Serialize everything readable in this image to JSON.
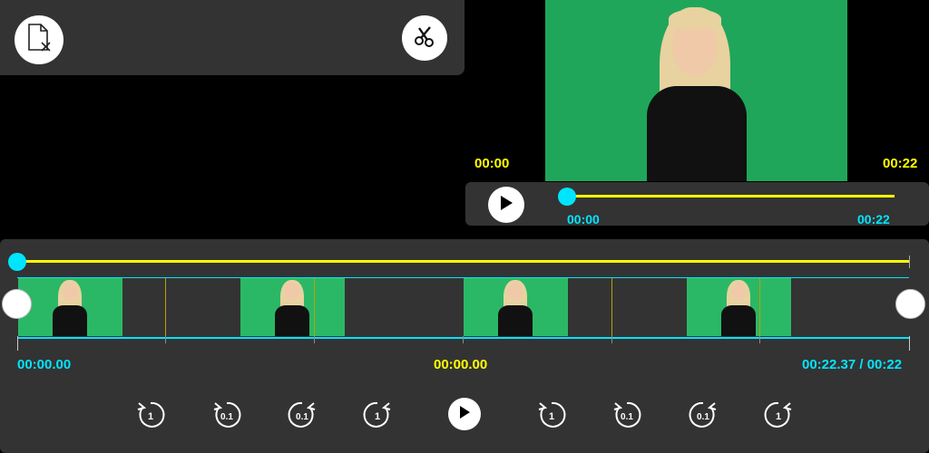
{
  "toolbar": {
    "left_icon": "file-remove-icon",
    "right_icon": "scissors-icon"
  },
  "player": {
    "time_start_label": "00:00",
    "time_end_label": "00:22",
    "current_time": "00:00",
    "duration": "00:22",
    "progress": 0.0
  },
  "timeline": {
    "start_time": "00:00.00",
    "current_time": "00:00.00",
    "end_time": "00:22.37 / 00:22"
  },
  "controls": {
    "icons": [
      "rewind-1-icon",
      "rewind-0.1-icon",
      "forward-0.1-icon",
      "forward-1-icon",
      "play-icon",
      "rewind-1-icon",
      "rewind-0.1-icon",
      "forward-0.1-icon",
      "forward-1-icon"
    ],
    "labels": [
      "1",
      "0.1",
      "0.1",
      "1",
      "1",
      "0.1",
      "0.1",
      "1"
    ]
  },
  "colors": {
    "accent_yellow": "#ffff00",
    "accent_cyan": "#00e5ff",
    "panel": "#333333",
    "background": "#000000"
  }
}
